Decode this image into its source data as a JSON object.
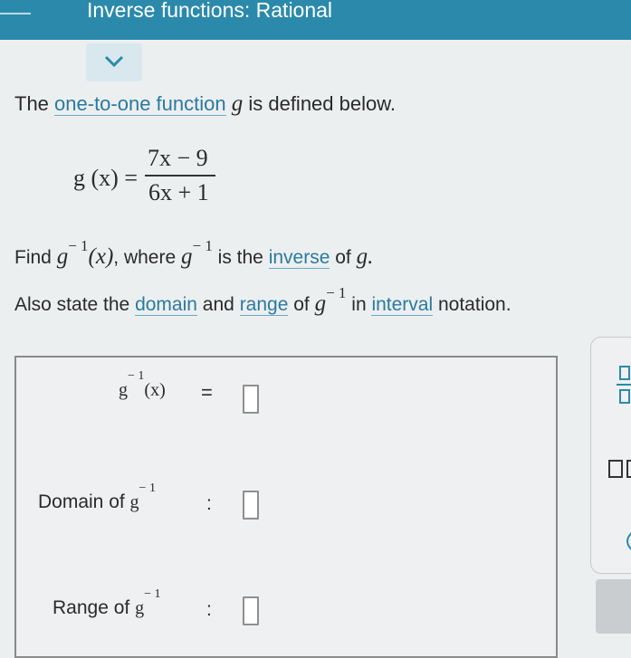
{
  "header": {
    "title": "Inverse functions: Rational"
  },
  "problem": {
    "intro_before": "The ",
    "intro_link": "one-to-one function",
    "intro_var": "g",
    "intro_after": " is defined below."
  },
  "formula": {
    "lhs": "g (x) =",
    "numerator": "7x − 9",
    "denominator": "6x + 1"
  },
  "instructions": {
    "line1_find": "Find ",
    "line1_g": "g",
    "line1_sup": "− 1",
    "line1_x": "(x)",
    "line1_where": ", where ",
    "line1_g2": "g",
    "line1_sup2": "− 1",
    "line1_is": " is the ",
    "line1_link": "inverse",
    "line1_of": " of ",
    "line1_g3": "g.",
    "line2_also": "Also state the ",
    "line2_domain": "domain",
    "line2_and": " and ",
    "line2_range": "range",
    "line2_of": " of ",
    "line2_g": "g",
    "line2_sup": "− 1",
    "line2_in": " in ",
    "line2_interval": "interval",
    "line2_notation": " notation."
  },
  "answer": {
    "inverse_g": "g",
    "inverse_sup": "− 1",
    "inverse_x": "(x)",
    "equals": "=",
    "domain_label": "Domain of ",
    "domain_g": "g",
    "domain_sup": "− 1",
    "range_label": "Range of ",
    "range_g": "g",
    "range_sup": "− 1",
    "colon": ":"
  }
}
